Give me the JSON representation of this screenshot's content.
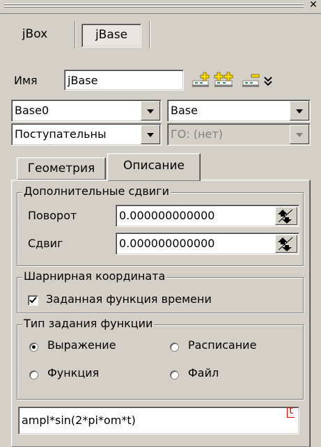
{
  "top_tabs": [
    {
      "label": "jBox",
      "active": false
    },
    {
      "label": "jBase",
      "active": true
    }
  ],
  "name_row": {
    "label": "Имя",
    "value": "jBase"
  },
  "row1": {
    "left_select": "Base0",
    "right_select": "Base"
  },
  "row2": {
    "left_select": "Поступательны",
    "right_select": "ГО: (нет)"
  },
  "sub_tabs": [
    {
      "label": "Геометрия",
      "active": false
    },
    {
      "label": "Описание",
      "active": true
    }
  ],
  "offsets_group": {
    "title": "Дополнительные сдвиги",
    "rotation_label": "Поворот",
    "rotation_value": "0.000000000000",
    "shift_label": "Сдвиг",
    "shift_value": "0.000000000000"
  },
  "joint_group": {
    "title": "Шарнирная координата",
    "checkbox_label": "Заданная функция времени",
    "checked": true
  },
  "function_group": {
    "title": "Тип задания функции",
    "options": [
      {
        "label": "Выражение",
        "selected": true
      },
      {
        "label": "Расписание",
        "selected": false
      },
      {
        "label": "Функция",
        "selected": false
      },
      {
        "label": "Файл",
        "selected": false
      }
    ]
  },
  "expression_value": "ampl*sin(2*pi*om*t)",
  "expression_marker": "t",
  "colors": {
    "face": "#d4d0c8",
    "icon_green": "#2e8b57",
    "icon_yellow": "#ffd800",
    "marker_red": "#e00000"
  }
}
